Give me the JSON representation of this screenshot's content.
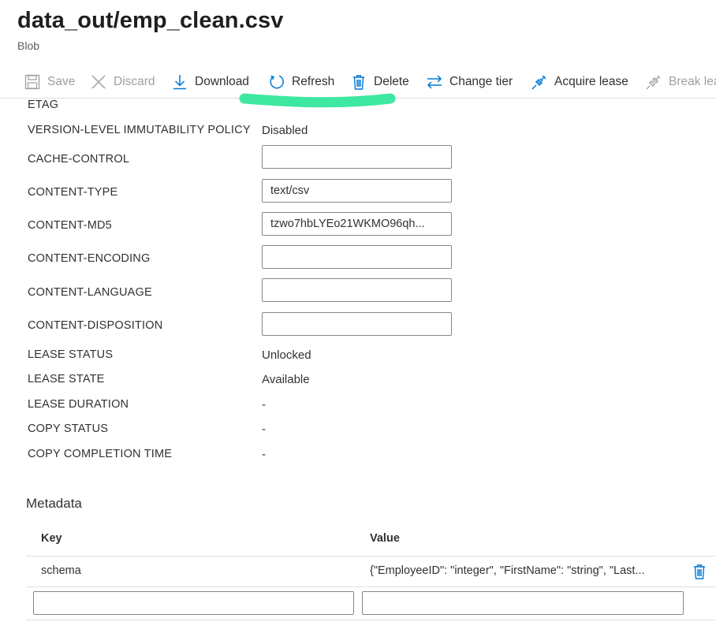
{
  "header": {
    "title": "data_out/emp_clean.csv",
    "subtitle": "Blob"
  },
  "toolbar": {
    "save": "Save",
    "discard": "Discard",
    "download": "Download",
    "refresh": "Refresh",
    "delete": "Delete",
    "change_tier": "Change tier",
    "acquire_lease": "Acquire lease",
    "break_lease": "Break lea"
  },
  "properties": {
    "etag": {
      "label": "ETAG",
      "value": ""
    },
    "immutability": {
      "label": "VERSION-LEVEL IMMUTABILITY POLICY",
      "value": "Disabled"
    },
    "cache_control": {
      "label": "CACHE-CONTROL",
      "value": ""
    },
    "content_type": {
      "label": "CONTENT-TYPE",
      "value": "text/csv"
    },
    "content_md5": {
      "label": "CONTENT-MD5",
      "value": "tzwo7hbLYEo21WKMO96qh..."
    },
    "content_encoding": {
      "label": "CONTENT-ENCODING",
      "value": ""
    },
    "content_language": {
      "label": "CONTENT-LANGUAGE",
      "value": ""
    },
    "content_disposition": {
      "label": "CONTENT-DISPOSITION",
      "value": ""
    },
    "lease_status": {
      "label": "LEASE STATUS",
      "value": "Unlocked"
    },
    "lease_state": {
      "label": "LEASE STATE",
      "value": "Available"
    },
    "lease_duration": {
      "label": "LEASE DURATION",
      "value": "-"
    },
    "copy_status": {
      "label": "COPY STATUS",
      "value": "-"
    },
    "copy_completion_time": {
      "label": "COPY COMPLETION TIME",
      "value": "-"
    }
  },
  "metadata": {
    "title": "Metadata",
    "key_header": "Key",
    "value_header": "Value",
    "rows": [
      {
        "key": "schema",
        "value": "{\"EmployeeID\": \"integer\", \"FirstName\": \"string\", \"Last..."
      }
    ]
  },
  "colors": {
    "accent": "#0078d4",
    "highlight_stroke": "#3ee8a0",
    "disabled_text": "#a19f9d"
  },
  "icons": {
    "save": "save-icon",
    "discard": "discard-x-icon",
    "download": "download-arrow-icon",
    "refresh": "refresh-icon",
    "delete": "trash-icon",
    "change_tier": "swap-arrows-icon",
    "acquire_lease": "plug-icon",
    "break_lease": "plug-disconnect-icon"
  }
}
